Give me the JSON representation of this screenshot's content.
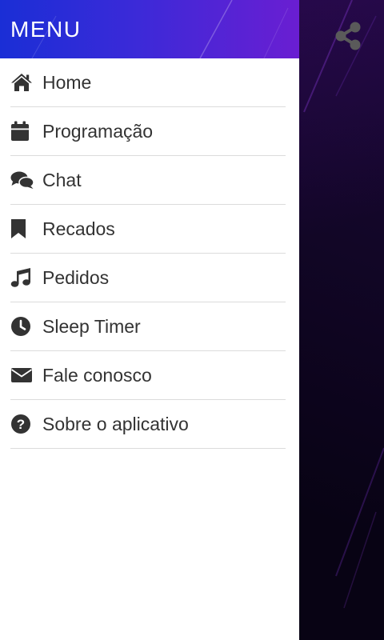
{
  "drawer": {
    "title": "MENU",
    "items": [
      {
        "label": "Home",
        "icon": "home-icon"
      },
      {
        "label": "Programação",
        "icon": "calendar-icon"
      },
      {
        "label": "Chat",
        "icon": "chat-icon"
      },
      {
        "label": "Recados",
        "icon": "bookmark-icon"
      },
      {
        "label": "Pedidos",
        "icon": "music-note-icon"
      },
      {
        "label": "Sleep Timer",
        "icon": "clock-icon"
      },
      {
        "label": "Fale conosco",
        "icon": "envelope-icon"
      },
      {
        "label": "Sobre o aplicativo",
        "icon": "question-circle-icon"
      }
    ]
  },
  "toolbar": {
    "share_icon": "share-icon"
  },
  "colors": {
    "header_start": "#1a2ed6",
    "header_end": "#6a1ed2",
    "backdrop": "#0e0620",
    "text": "#333333",
    "share_icon": "#5a5a5a"
  }
}
